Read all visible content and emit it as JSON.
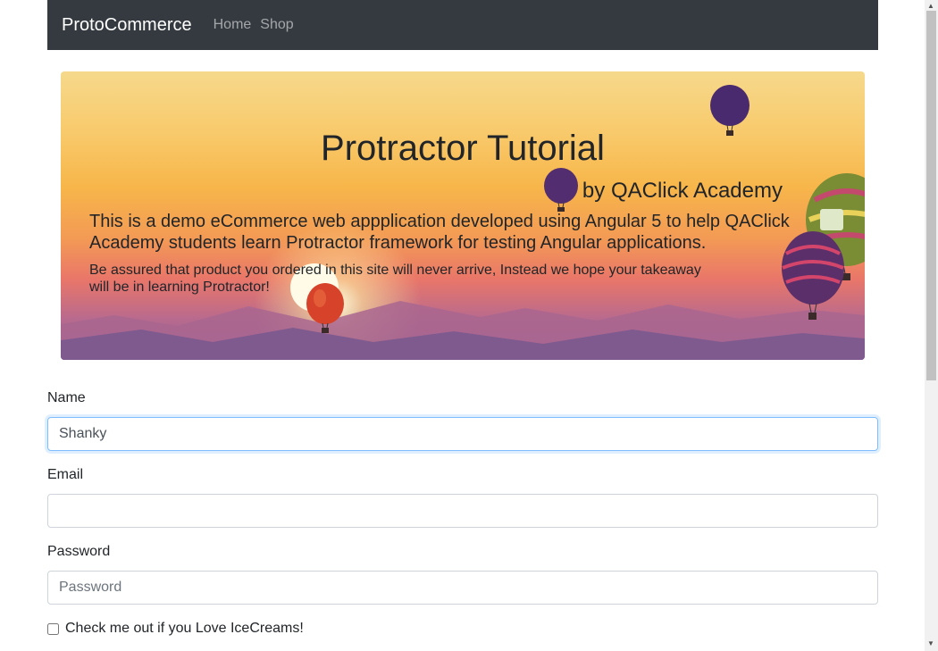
{
  "navbar": {
    "brand": "ProtoCommerce",
    "links": [
      "Home",
      "Shop"
    ]
  },
  "hero": {
    "title": "Protractor Tutorial",
    "subtitle": "by QAClick Academy",
    "lead": "This is a demo eCommerce web appplication developed using Angular 5 to help QAClick Academy students learn Protractor framework for testing Angular applications.",
    "text": "Be assured that product you ordered in this site will never arrive, Instead we hope your takeaway will be in learning Protractor!"
  },
  "form": {
    "name": {
      "label": "Name",
      "value": "Shanky"
    },
    "email": {
      "label": "Email",
      "value": ""
    },
    "password": {
      "label": "Password",
      "placeholder": "Password"
    },
    "checkbox": {
      "label": "Check me out if you Love IceCreams!",
      "checked": false
    }
  },
  "colors": {
    "navbar_bg": "#343a40",
    "focus_border": "#80bdff"
  }
}
